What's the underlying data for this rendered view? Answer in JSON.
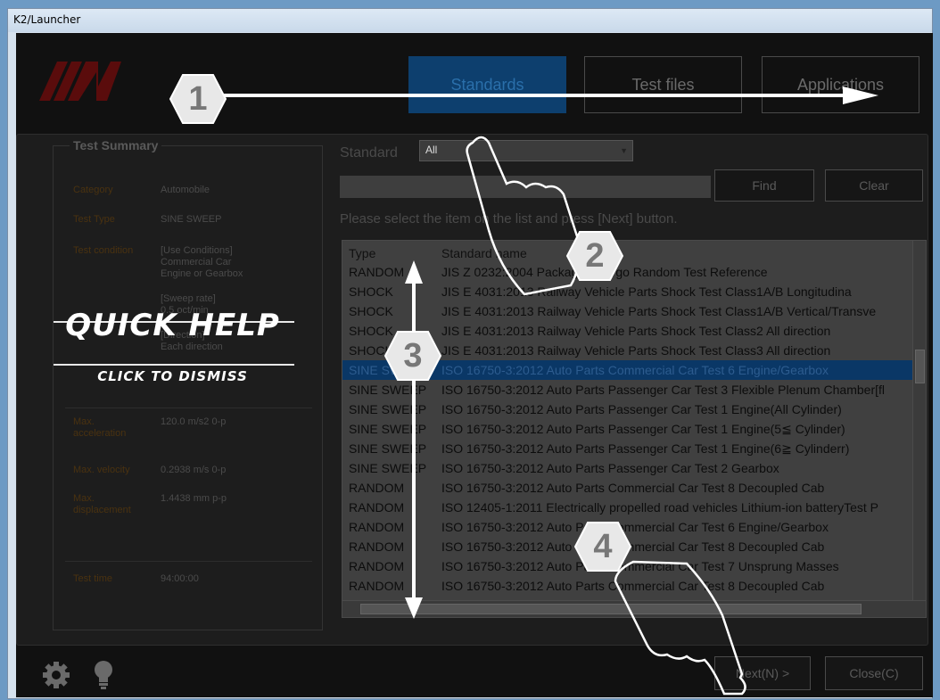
{
  "window": {
    "title": "K2/Launcher"
  },
  "tabs": [
    {
      "label": "Standards",
      "active": true
    },
    {
      "label": "Test files",
      "active": false
    },
    {
      "label": "Applications",
      "active": false
    }
  ],
  "summary": {
    "title": "Test Summary",
    "category_label": "Category",
    "category_value": "Automobile",
    "test_type_label": "Test Type",
    "test_type_value": "SINE SWEEP",
    "test_condition_label": "Test condition",
    "cond_line1": "[Use Conditions]",
    "cond_line2": "Commercial Car",
    "cond_line3": "Engine or Gearbox",
    "sweep_line1": "[Sweep rate]",
    "sweep_line2": "0.5 oct/min",
    "dir_line1": "[Direction]",
    "dir_line2": "Each direction",
    "max_acc_label": "Max. acceleration",
    "max_acc_value": "120.0 m/s2 0-p",
    "max_vel_label": "Max. velocity",
    "max_vel_value": "0.2938 m/s 0-p",
    "max_disp_label": "Max. displacement",
    "max_disp_value": "1.4438 mm p-p",
    "test_time_label": "Test time",
    "test_time_value": "94:00:00"
  },
  "filter": {
    "standard_label": "Standard",
    "standard_value": "All",
    "search_value": "",
    "find_label": "Find",
    "clear_label": "Clear",
    "instruction": "Please select the item on the list and press [Next] button."
  },
  "list": {
    "columns": [
      "Type",
      "Standard name"
    ],
    "rows": [
      {
        "type": "RANDOM",
        "name": "JIS Z 0232:2004 Packaged Cargo Random Test Reference"
      },
      {
        "type": "SHOCK",
        "name": "JIS E 4031:2013 Railway Vehicle Parts Shock Test Class1A/B Longitudina"
      },
      {
        "type": "SHOCK",
        "name": "JIS E 4031:2013 Railway Vehicle Parts Shock Test Class1A/B Vertical/Transve"
      },
      {
        "type": "SHOCK",
        "name": "JIS E 4031:2013 Railway Vehicle Parts Shock Test Class2 All direction"
      },
      {
        "type": "SHOCK",
        "name": "JIS E 4031:2013 Railway Vehicle Parts Shock Test Class3 All direction"
      },
      {
        "type": "SINE SWEEP",
        "name": "ISO 16750-3:2012 Auto Parts Commercial Car Test 6 Engine/Gearbox",
        "selected": true
      },
      {
        "type": "SINE SWEEP",
        "name": "ISO 16750-3:2012 Auto Parts Passenger Car Test 3 Flexible Plenum Chamber[fl"
      },
      {
        "type": "SINE SWEEP",
        "name": "ISO 16750-3:2012 Auto Parts Passenger Car Test 1 Engine(All Cylinder)"
      },
      {
        "type": "SINE SWEEP",
        "name": "ISO 16750-3:2012 Auto Parts Passenger Car Test 1 Engine(5≦ Cylinder)"
      },
      {
        "type": "SINE SWEEP",
        "name": "ISO 16750-3:2012 Auto Parts Passenger Car Test 1 Engine(6≧ Cylinderr)"
      },
      {
        "type": "SINE SWEEP",
        "name": "ISO 16750-3:2012 Auto Parts Passenger Car Test 2 Gearbox"
      },
      {
        "type": "RANDOM",
        "name": "ISO 16750-3:2012 Auto Parts Commercial Car Test 8 Decoupled Cab"
      },
      {
        "type": "RANDOM",
        "name": "ISO 12405-1:2011 Electrically propelled road vehicles Lithium-ion batteryTest P"
      },
      {
        "type": "RANDOM",
        "name": "ISO 16750-3:2012 Auto Parts Commercial Car Test 6 Engine/Gearbox"
      },
      {
        "type": "RANDOM",
        "name": "ISO 16750-3:2012 Auto Parts Commercial Car Test 8 Decoupled Cab"
      },
      {
        "type": "RANDOM",
        "name": "ISO 16750-3:2012 Auto Parts Commercial Car Test 7 Unsprung Masses"
      },
      {
        "type": "RANDOM",
        "name": "ISO 16750-3:2012 Auto Parts Commercial Car Test 8 Decoupled Cab"
      }
    ]
  },
  "footer": {
    "next_label": "Next(N) >",
    "close_label": "Close(C)",
    "settings_icon": "gear-icon",
    "hint_icon": "lightbulb-icon"
  },
  "quick_help": {
    "title": "QUICK HELP",
    "subtitle": "CLICK TO DISMISS",
    "markers": [
      "1",
      "2",
      "3",
      "4"
    ]
  }
}
